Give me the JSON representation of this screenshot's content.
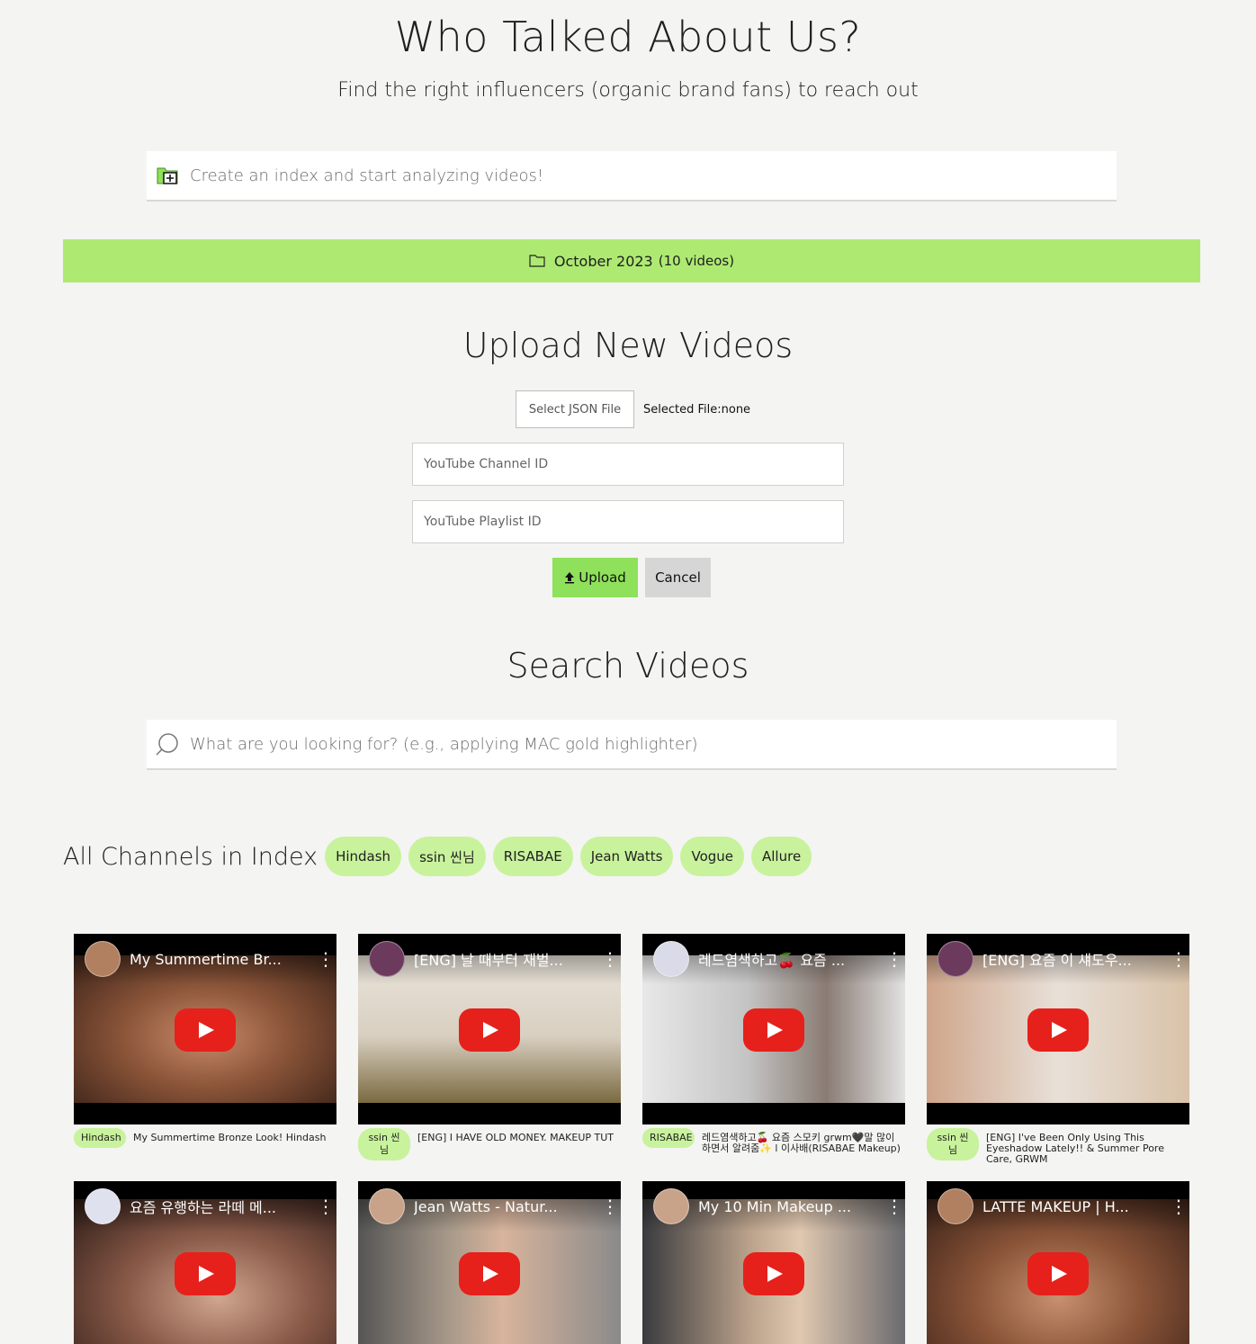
{
  "header": {
    "title": "Who Talked About Us?",
    "subtitle": "Find the right influencers (organic brand fans) to reach out"
  },
  "index_input": {
    "placeholder": "Create an index and start analyzing videos!",
    "icon": "folder-plus-icon"
  },
  "current_index": {
    "name": "October 2023",
    "count": "(10 videos)",
    "icon": "folder-icon"
  },
  "upload": {
    "title": "Upload New Videos",
    "select_file_label": "Select JSON File",
    "selected_file_text": "Selected File:none",
    "channel_placeholder": "YouTube Channel ID",
    "playlist_placeholder": "YouTube Playlist ID",
    "upload_label": "Upload",
    "cancel_label": "Cancel"
  },
  "search": {
    "title": "Search Videos",
    "placeholder": "What are you looking for? (e.g., applying MAC gold highlighter)",
    "icon": "search-icon"
  },
  "channels": {
    "title": "All Channels in Index",
    "items": [
      "Hindash",
      "ssin 씬님",
      "RISABAE",
      "Jean Watts",
      "Vogue",
      "Allure"
    ]
  },
  "videos": [
    {
      "title": "My Summertime Br...",
      "channel": "Hindash",
      "desc": "My Summertime Bronze Look! Hindash"
    },
    {
      "title": "[ENG] 날 때부터 재벌...",
      "channel": "ssin 씬님",
      "desc": "[ENG] I HAVE OLD MONEY. MAKEUP TUT"
    },
    {
      "title": "레드염색하고🍒 요즘 ...",
      "channel": "RISABAE",
      "desc": "레드염색하고🍒 요즘 스모키 grwm🖤말 많이 하면서 알려줌✨ l 이사배(RISABAE Makeup)"
    },
    {
      "title": "[ENG] 요즘 이 섀도우...",
      "channel": "ssin 씬님",
      "desc": "[ENG] I've Been Only Using This Eyeshadow Lately!! & Summer Pore Care, GRWM"
    },
    {
      "title": "요즘 유행하는 라떼 메...",
      "channel": "",
      "desc": ""
    },
    {
      "title": "Jean Watts - Natur...",
      "channel": "",
      "desc": ""
    },
    {
      "title": "My 10 Min Makeup ...",
      "channel": "",
      "desc": ""
    },
    {
      "title": "LATTE MAKEUP | H...",
      "channel": "",
      "desc": ""
    }
  ],
  "colors": {
    "accent": "#aeea72",
    "chip": "#c8f29c",
    "upload_button": "#8fe05a",
    "play_button": "#e6201b"
  }
}
